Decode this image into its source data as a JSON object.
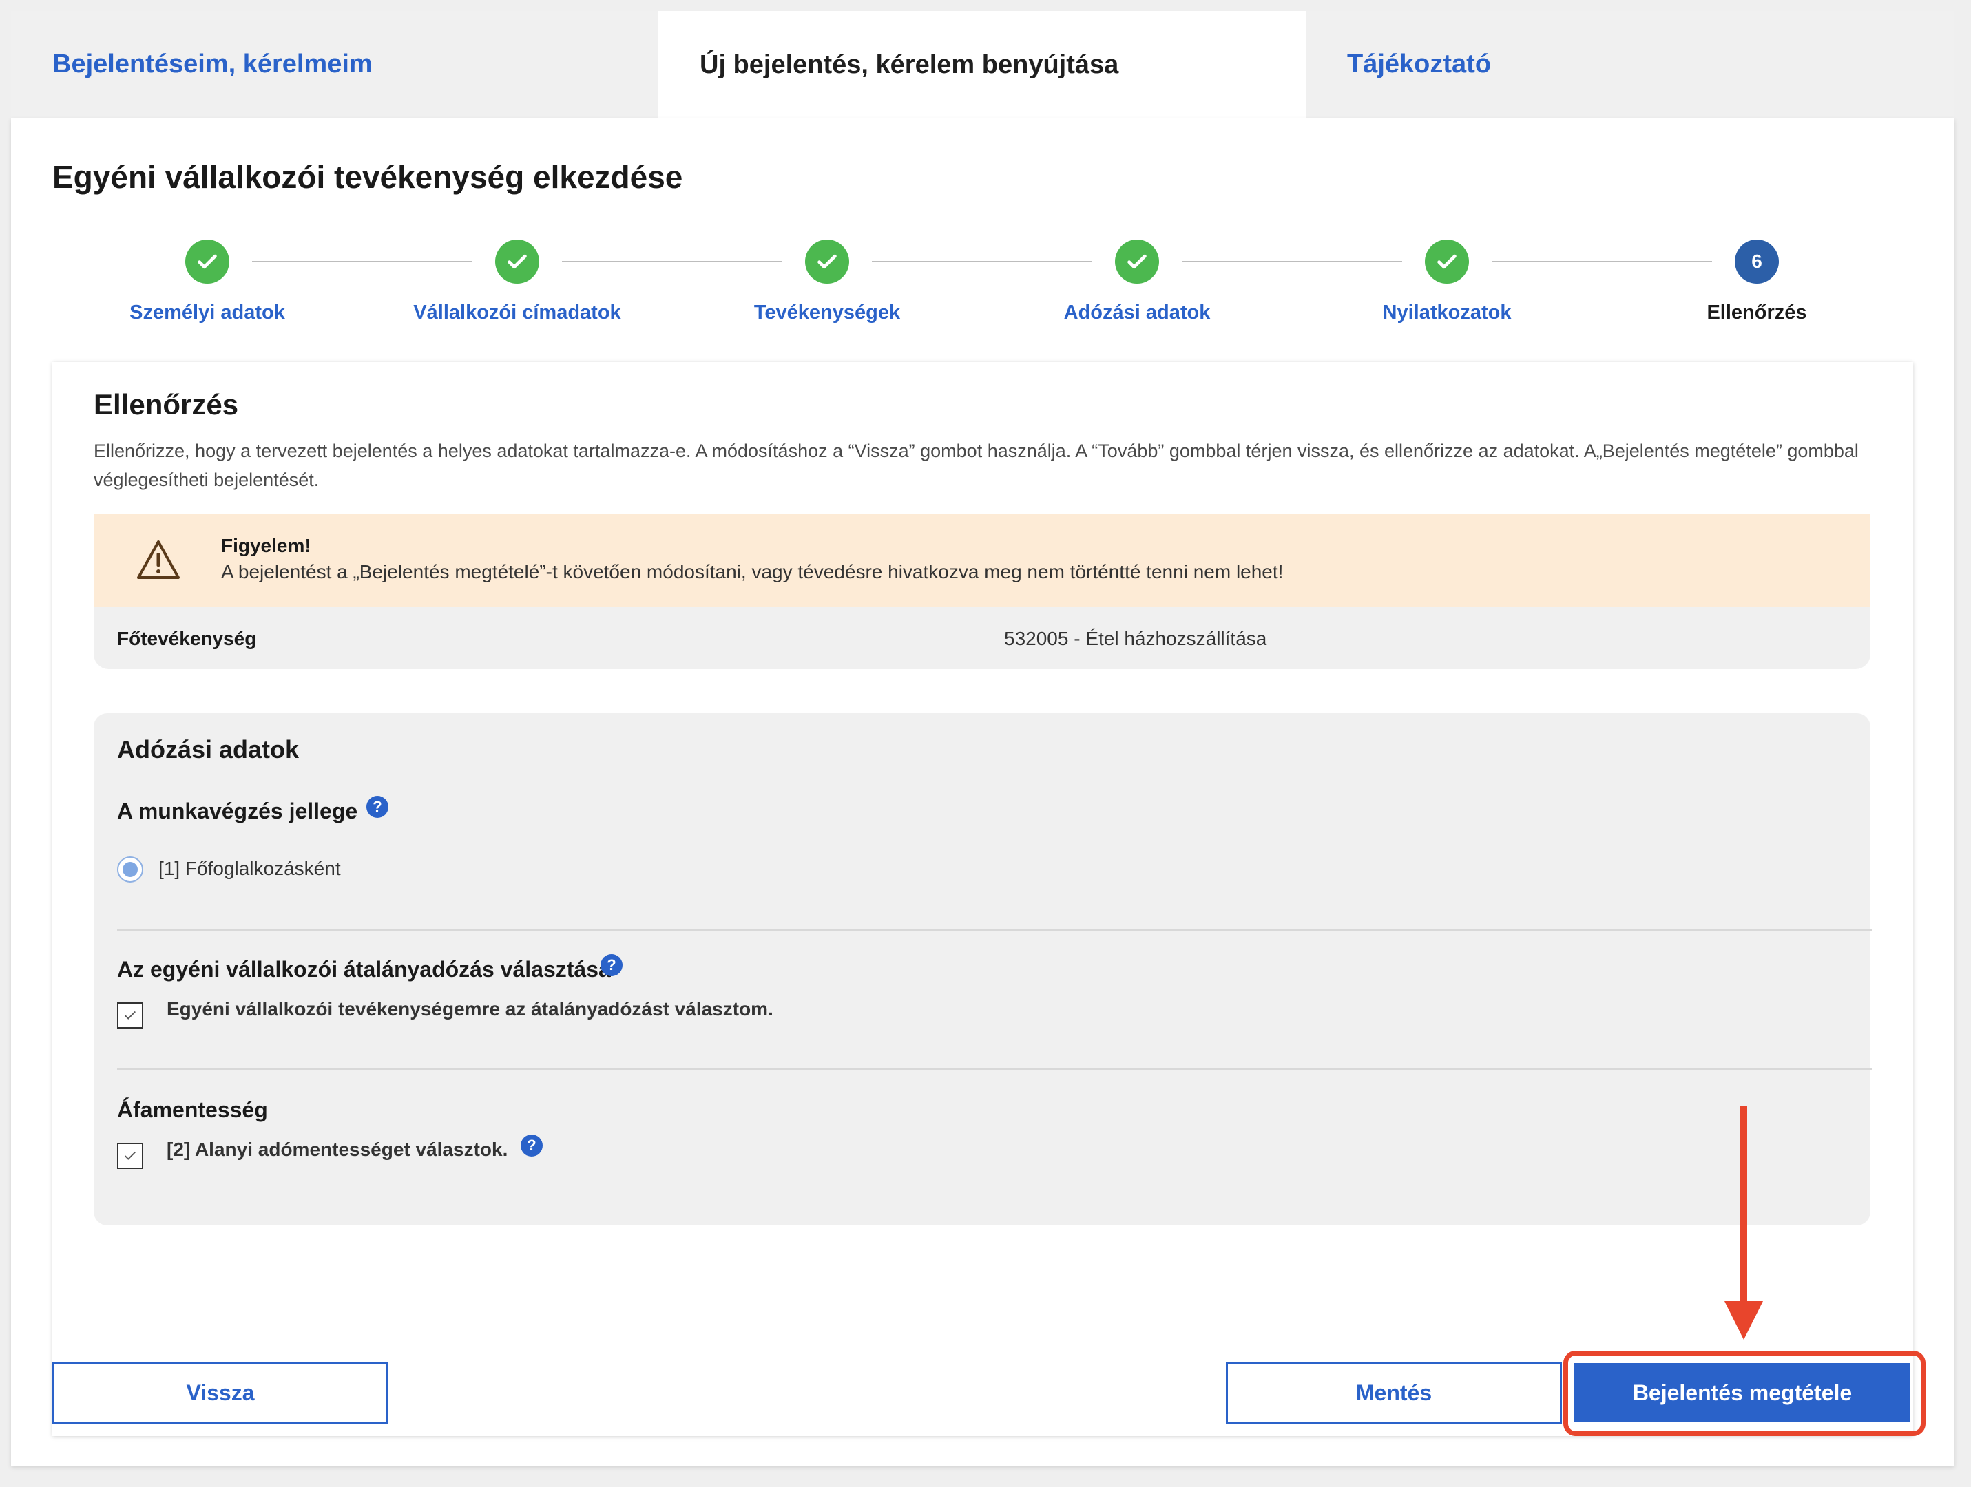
{
  "tabs": [
    {
      "label": "Bejelentéseim, kérelmeim",
      "active": false
    },
    {
      "label": "Új bejelentés, kérelem benyújtása",
      "active": true
    },
    {
      "label": "Tájékoztató",
      "active": false
    }
  ],
  "page": {
    "title": "Egyéni vállalkozói tevékenység elkezdése"
  },
  "stepper": {
    "steps": [
      {
        "label": "Személyi adatok",
        "state": "done"
      },
      {
        "label": "Vállalkozói címadatok",
        "state": "done"
      },
      {
        "label": "Tevékenységek",
        "state": "done"
      },
      {
        "label": "Adózási adatok",
        "state": "done"
      },
      {
        "label": "Nyilatkozatok",
        "state": "done"
      },
      {
        "label": "Ellenőrzés",
        "state": "active",
        "number": "6"
      }
    ]
  },
  "review": {
    "title": "Ellenőrzés",
    "description": "Ellenőrizze, hogy a tervezett bejelentés a helyes adatokat tartalmazza-e. A módosításhoz a “Vissza” gombot használja. A “Tovább” gombbal térjen vissza, és ellenőrizze az adatokat. A„Bejelentés megtétele” gombbal véglegesítheti bejelentését.",
    "warning": {
      "title": "Figyelem!",
      "text": "A bejelentést a „Bejelentés megtételé”-t követően módosítani, vagy tévedésre hivatkozva meg nem történtté tenni nem lehet!"
    },
    "main_activity": {
      "label": "Főtevékenység",
      "value": "532005 - Étel házhozszállítása"
    },
    "tax": {
      "title": "Adózási adatok",
      "work_nature": {
        "label": "A munkavégzés jellege",
        "option": "[1] Főfoglalkozásként",
        "help": "?"
      },
      "flat_rate": {
        "label": "Az egyéni vállalkozói átalányadózás választása",
        "option": "Egyéni vállalkozói tevékenységemre az átalányadózást választom.",
        "help": "?"
      },
      "vat_exempt": {
        "label": "Áfamentesség",
        "option": "[2] Alanyi adómentességet választok.",
        "help": "?"
      }
    }
  },
  "actions": {
    "back_label": "Vissza",
    "save_label": "Mentés",
    "submit_label": "Bejelentés megtétele"
  },
  "colors": {
    "accent": "#2a62c9",
    "step_done": "#4cb84f",
    "step_active": "#2c5fa8",
    "warning_bg": "#fdebd6",
    "annotation": "#e8452c"
  }
}
